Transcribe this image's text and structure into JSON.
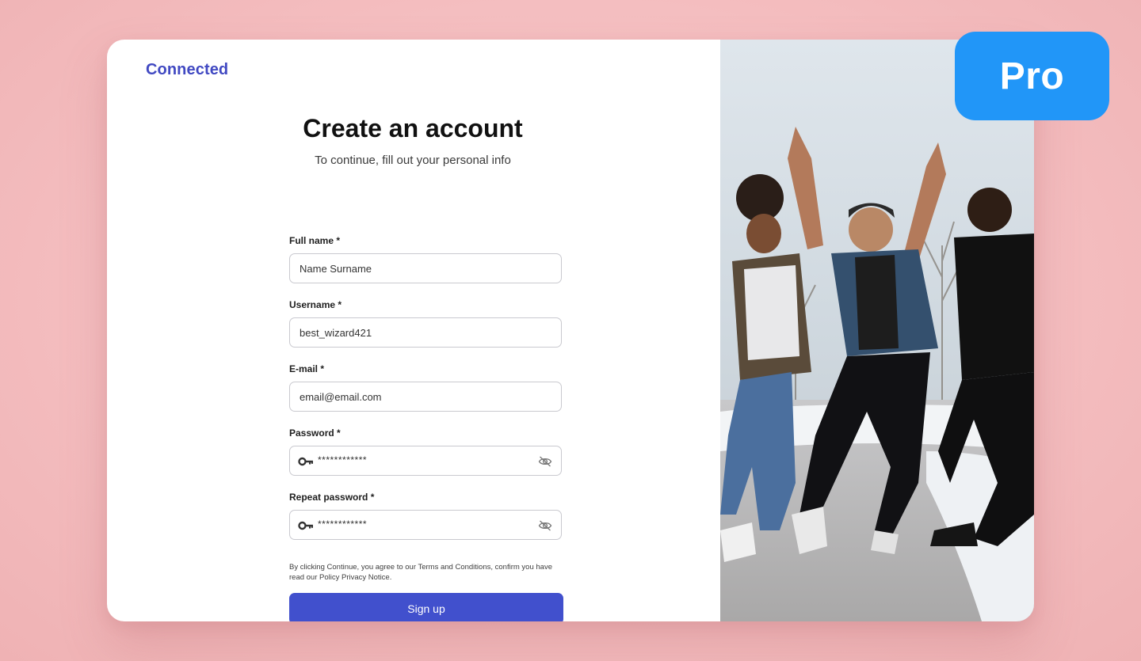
{
  "brand": "Connected",
  "heading": "Create an account",
  "subheading": "To continue, fill out your personal info",
  "fields": {
    "full_name": {
      "label": "Full name *",
      "value": "Name Surname"
    },
    "username": {
      "label": "Username *",
      "value": "best_wizard421"
    },
    "email": {
      "label": "E-mail *",
      "value": "email@email.com"
    },
    "password": {
      "label": "Password *",
      "value": "************"
    },
    "repeat_password": {
      "label": "Repeat password *",
      "value": "************"
    }
  },
  "legal_text": "By clicking Continue, you agree to our Terms and Conditions, confirm you have read our Policy Privacy Notice.",
  "signup_label": "Sign up",
  "badge": "Pro",
  "icons": [
    "key-icon",
    "eye-off-icon"
  ],
  "colors": {
    "brand": "#4149c2",
    "button": "#4150cd",
    "badge": "#2196f8",
    "background": "#f4bdbf"
  }
}
